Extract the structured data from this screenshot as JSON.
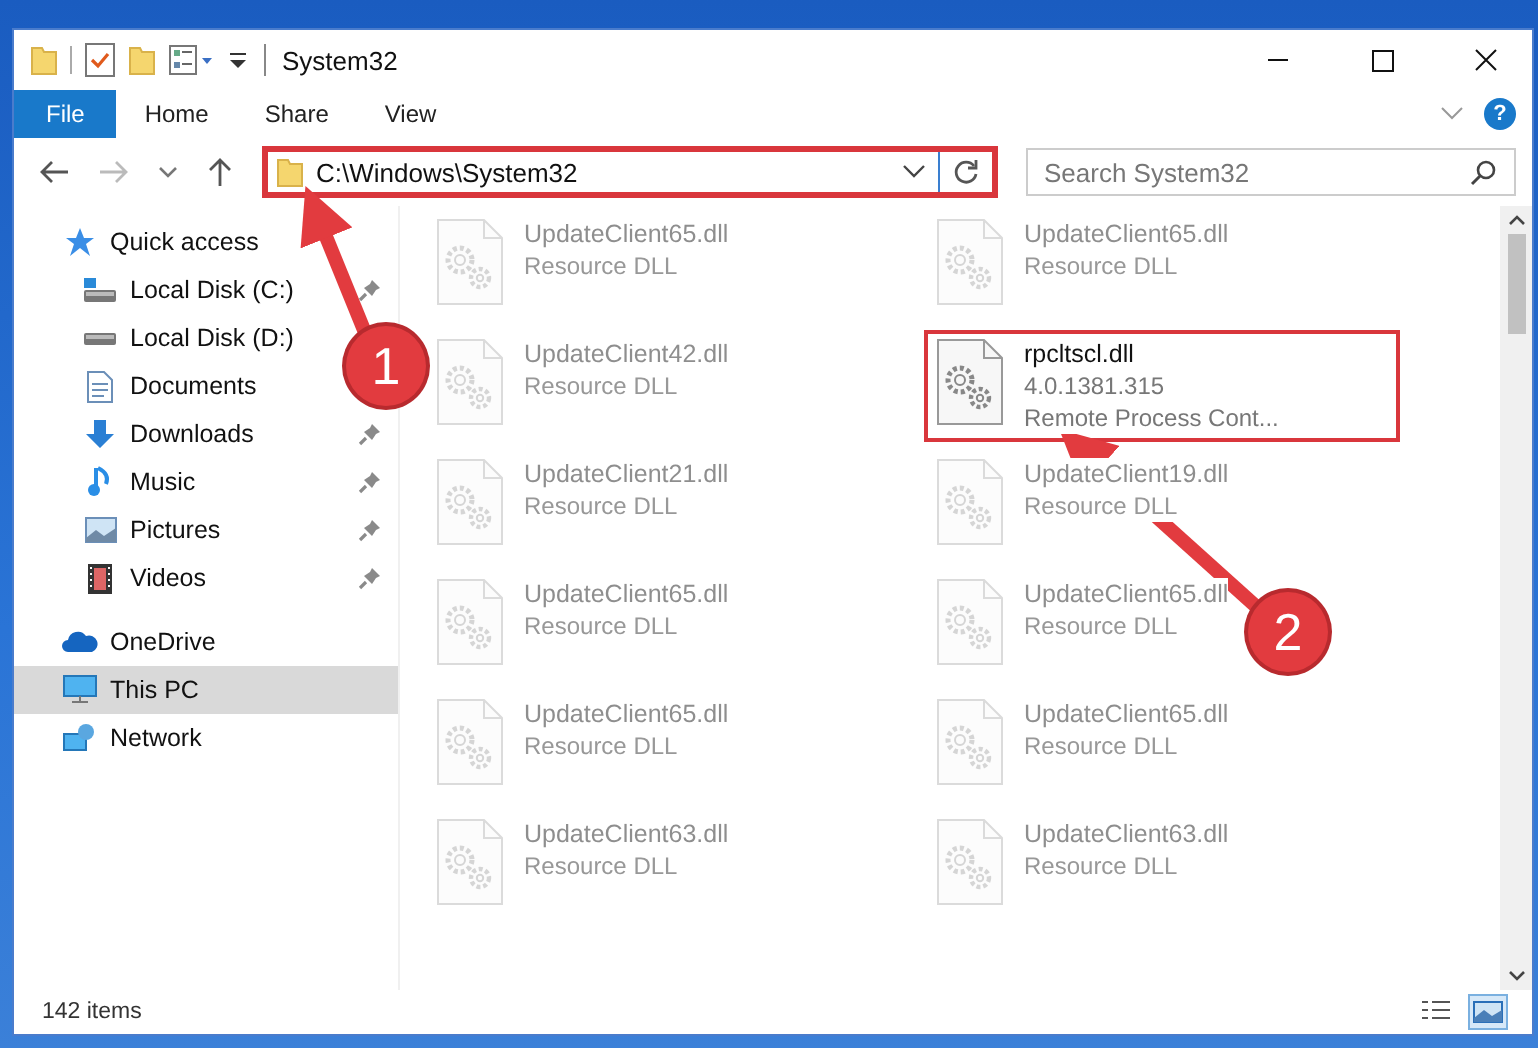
{
  "window": {
    "title": "System32"
  },
  "ribbon_tabs": [
    {
      "label": "File",
      "selected": true
    },
    {
      "label": "Home",
      "selected": false
    },
    {
      "label": "Share",
      "selected": false
    },
    {
      "label": "View",
      "selected": false
    }
  ],
  "help_button": "?",
  "address_bar": {
    "path": "C:\\Windows\\System32",
    "highlighted": true
  },
  "search": {
    "placeholder": "Search System32"
  },
  "sidebar": {
    "items": [
      {
        "label": "Quick access",
        "kind": "star",
        "selected": false,
        "children": [
          {
            "label": "Local Disk (C:)",
            "kind": "drive-win",
            "pinned": true,
            "selected": false
          },
          {
            "label": "Local Disk (D:)",
            "kind": "drive",
            "selected": false
          },
          {
            "label": "Documents",
            "kind": "documents",
            "selected": false
          },
          {
            "label": "Downloads",
            "kind": "download",
            "pinned": true,
            "selected": false
          },
          {
            "label": "Music",
            "kind": "music",
            "pinned": true,
            "selected": false
          },
          {
            "label": "Pictures",
            "kind": "pictures",
            "pinned": true,
            "selected": false
          },
          {
            "label": "Videos",
            "kind": "videos",
            "pinned": true,
            "selected": false
          }
        ]
      },
      {
        "label": "OneDrive",
        "kind": "cloud",
        "selected": false
      },
      {
        "label": "This PC",
        "kind": "pc",
        "selected": true
      },
      {
        "label": "Network",
        "kind": "network",
        "selected": false
      }
    ]
  },
  "files": [
    {
      "name": "UpdateClient65.dll",
      "details": [
        "Resource DLL"
      ],
      "blurred": true,
      "highlighted": false
    },
    {
      "name": "UpdateClient65.dll",
      "details": [
        "Resource DLL"
      ],
      "blurred": true,
      "highlighted": false
    },
    {
      "name": "UpdateClient42.dll",
      "details": [
        "Resource DLL"
      ],
      "blurred": true,
      "highlighted": false
    },
    {
      "name": "rpcltscl.dll",
      "details": [
        "4.0.1381.315",
        "Remote Process Cont..."
      ],
      "blurred": false,
      "highlighted": true
    },
    {
      "name": "UpdateClient21.dll",
      "details": [
        "Resource DLL"
      ],
      "blurred": true,
      "highlighted": false
    },
    {
      "name": "UpdateClient19.dll",
      "details": [
        "Resource DLL"
      ],
      "blurred": true,
      "highlighted": false
    },
    {
      "name": "UpdateClient65.dll",
      "details": [
        "Resource DLL"
      ],
      "blurred": true,
      "highlighted": false
    },
    {
      "name": "UpdateClient65.dll",
      "details": [
        "Resource DLL"
      ],
      "blurred": true,
      "highlighted": false
    },
    {
      "name": "UpdateClient65.dll",
      "details": [
        "Resource DLL"
      ],
      "blurred": true,
      "highlighted": false
    },
    {
      "name": "UpdateClient65.dll",
      "details": [
        "Resource DLL"
      ],
      "blurred": true,
      "highlighted": false
    },
    {
      "name": "UpdateClient63.dll",
      "details": [
        "Resource DLL"
      ],
      "blurred": true,
      "highlighted": false
    },
    {
      "name": "UpdateClient63.dll",
      "details": [
        "Resource DLL"
      ],
      "blurred": true,
      "highlighted": false
    }
  ],
  "status_bar": {
    "item_count": "142 items",
    "views": [
      {
        "kind": "details",
        "selected": false
      },
      {
        "kind": "large-icons",
        "selected": true
      }
    ]
  },
  "annotations": [
    {
      "label": "1"
    },
    {
      "label": "2"
    }
  ]
}
